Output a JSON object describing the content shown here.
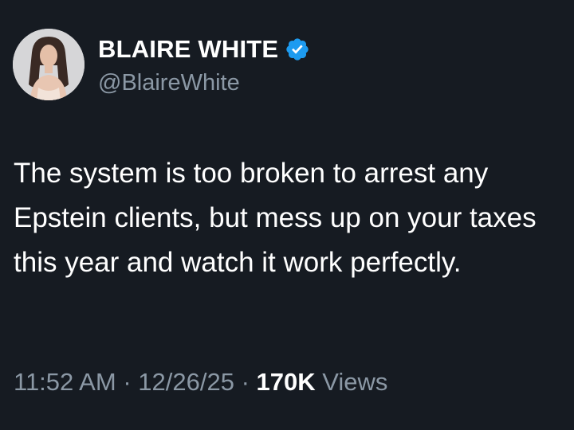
{
  "author": {
    "display_name": "BLAIRE WHITE",
    "handle": "@BlaireWhite",
    "verified": true,
    "verified_color": "#1d9bf0"
  },
  "tweet": {
    "text": "The system is too broken to arrest any Epstein clients, but mess up on your taxes this year and watch it work perfectly."
  },
  "meta": {
    "time": "11:52 AM",
    "separator": "·",
    "date": "12/26/25",
    "views_count": "170K",
    "views_label": "Views"
  },
  "colors": {
    "background": "#161b22",
    "primary_text": "#ffffff",
    "secondary_text": "#8b98a5"
  }
}
